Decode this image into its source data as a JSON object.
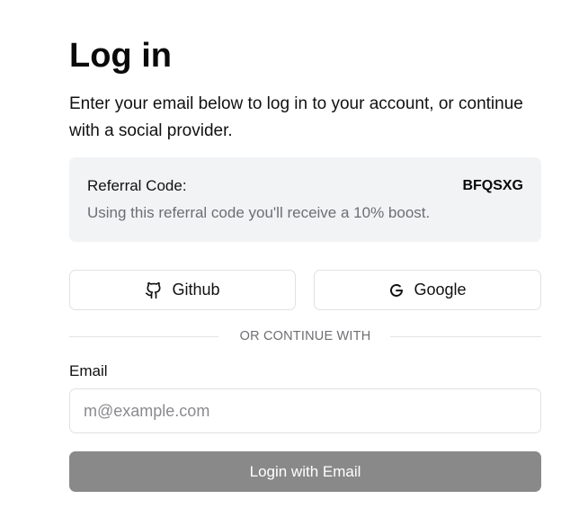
{
  "header": {
    "title": "Log in",
    "subtitle": "Enter your email below to log in to your account, or continue with a social provider."
  },
  "referral": {
    "label": "Referral Code:",
    "code": "BFQSXG",
    "description": "Using this referral code you'll receive a 10% boost."
  },
  "social": {
    "github": {
      "label": "Github",
      "icon": "github-icon"
    },
    "google": {
      "label": "Google",
      "icon": "google-icon"
    }
  },
  "divider": {
    "text": "OR CONTINUE WITH"
  },
  "email": {
    "label": "Email",
    "value": "",
    "placeholder": "m@example.com"
  },
  "submit": {
    "label": "Login with Email",
    "color": "#898989"
  },
  "colors": {
    "panel_bg": "#f2f3f5",
    "border": "#e1e1e4",
    "muted_text": "#6e6e73"
  }
}
